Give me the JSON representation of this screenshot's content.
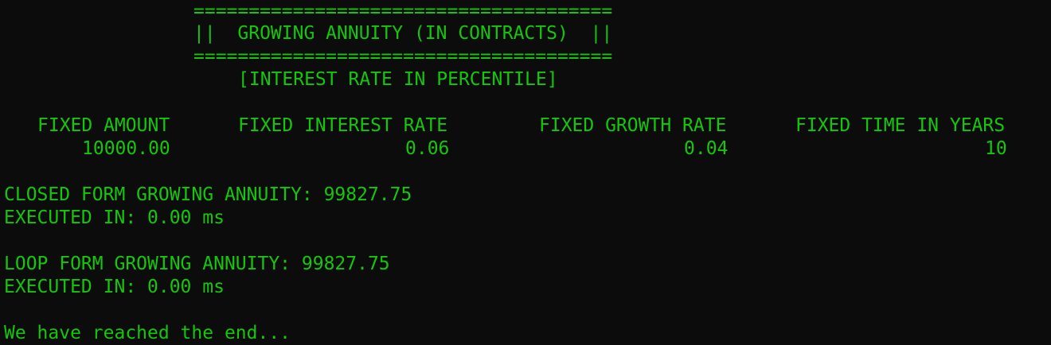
{
  "banner": {
    "border_top": "======================================",
    "title_line": "||  GROWING ANNUITY (IN CONTRACTS)  ||",
    "border_bottom": "======================================",
    "subtitle": "[INTEREST RATE IN PERCENTILE]"
  },
  "inputs_table": {
    "headers": [
      "FIXED AMOUNT",
      "FIXED INTEREST RATE",
      "FIXED GROWTH RATE",
      "FIXED TIME IN YEARS"
    ],
    "values": [
      "10000.00",
      "0.06",
      "0.04",
      "10"
    ]
  },
  "results": {
    "closed_form": {
      "label": "CLOSED FORM GROWING ANNUITY: 99827.75",
      "time": "EXECUTED IN: 0.00 ms"
    },
    "loop_form": {
      "label": "LOOP FORM GROWING ANNUITY: 99827.75",
      "time": "EXECUTED IN: 0.00 ms"
    }
  },
  "footer": {
    "message": "We have reached the end..."
  },
  "colors": {
    "background": "#0c0c0c",
    "text": "#16c60c"
  }
}
